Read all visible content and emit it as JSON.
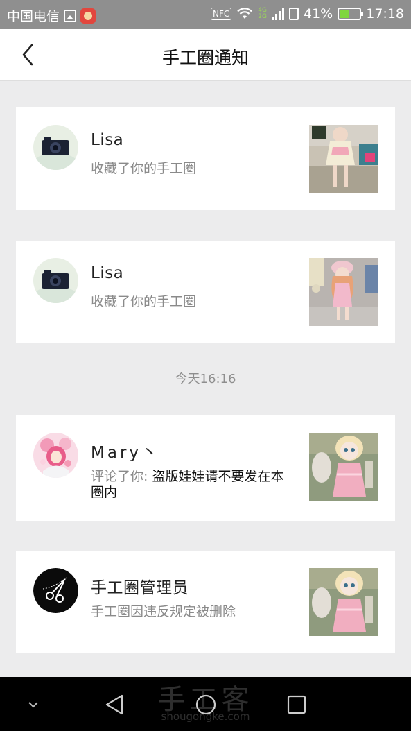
{
  "status_bar": {
    "carrier": "中国电信",
    "nfc": "NFC",
    "network": [
      "4G",
      "2G"
    ],
    "battery_percent": "41%",
    "battery_level": 0.41,
    "time": "17:18"
  },
  "header": {
    "title": "手工圈通知"
  },
  "notifications": [
    {
      "name": "Lisa",
      "action": "收藏了你的手工圈",
      "comment": ""
    },
    {
      "name": "Lisa",
      "action": "收藏了你的手工圈",
      "comment": ""
    },
    {
      "name": "Mary丶",
      "action": "评论了你: ",
      "comment": "盗版娃娃请不要发在本圈内"
    },
    {
      "name": "手工圈管理员",
      "action": "手工圈因违反规定被删除",
      "comment": ""
    }
  ],
  "time_separator": "今天16:16",
  "watermark": {
    "title": "手工客",
    "url": "shougongke.com"
  },
  "colors": {
    "background": "#ececed",
    "status_bar": "#8f8f8f",
    "secondary_text": "#8a8a8a"
  }
}
